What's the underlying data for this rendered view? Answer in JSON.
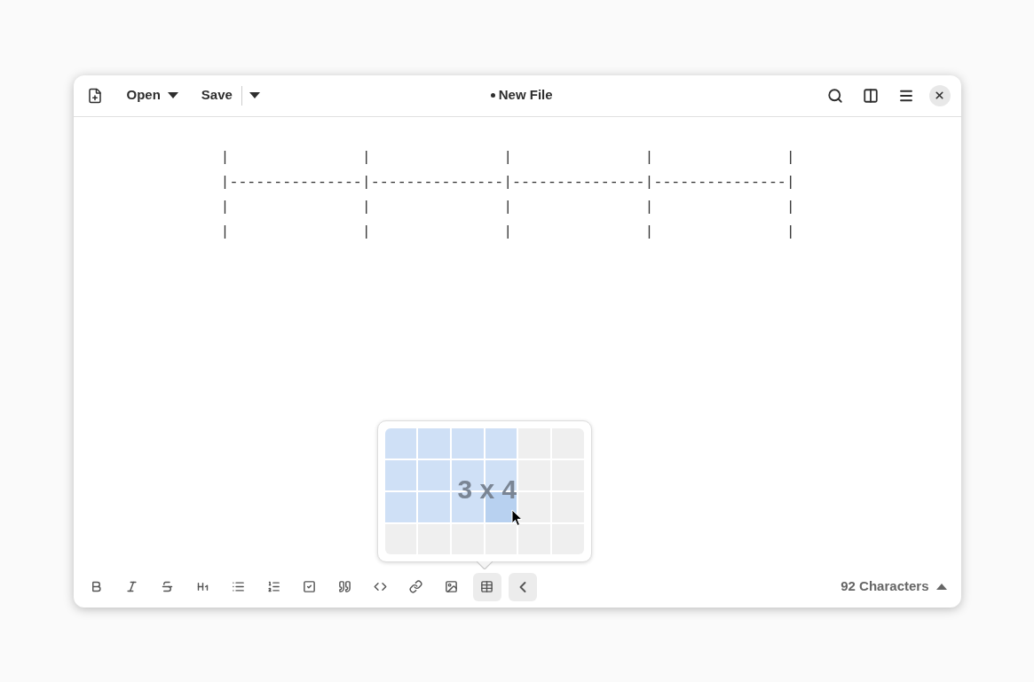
{
  "header": {
    "open_label": "Open",
    "save_label": "Save",
    "title": "New File",
    "modified": true
  },
  "editor": {
    "lines": [
      "|               |               |               |               |",
      "|---------------|---------------|---------------|---------------|",
      "|               |               |               |               |",
      "|               |               |               |               |"
    ]
  },
  "table_picker": {
    "label": "3 x 4",
    "rows": [
      [
        {
          "selected": true,
          "hovered": false
        },
        {
          "selected": true,
          "hovered": false
        },
        {
          "selected": true,
          "hovered": false
        },
        {
          "selected": true,
          "hovered": false
        },
        {
          "selected": false,
          "hovered": false
        },
        {
          "selected": false,
          "hovered": false
        }
      ],
      [
        {
          "selected": true,
          "hovered": false
        },
        {
          "selected": true,
          "hovered": false
        },
        {
          "selected": true,
          "hovered": false
        },
        {
          "selected": true,
          "hovered": false
        },
        {
          "selected": false,
          "hovered": false
        },
        {
          "selected": false,
          "hovered": false
        }
      ],
      [
        {
          "selected": true,
          "hovered": false
        },
        {
          "selected": true,
          "hovered": false
        },
        {
          "selected": true,
          "hovered": false
        },
        {
          "selected": true,
          "hovered": true
        },
        {
          "selected": false,
          "hovered": false
        },
        {
          "selected": false,
          "hovered": false
        }
      ],
      [
        {
          "selected": false,
          "hovered": false
        },
        {
          "selected": false,
          "hovered": false
        },
        {
          "selected": false,
          "hovered": false
        },
        {
          "selected": false,
          "hovered": false
        },
        {
          "selected": false,
          "hovered": false
        },
        {
          "selected": false,
          "hovered": false
        }
      ]
    ]
  },
  "toolbar": [
    {
      "kind": "bold",
      "selected": false
    },
    {
      "kind": "italic",
      "selected": false
    },
    {
      "kind": "strike",
      "selected": false
    },
    {
      "kind": "heading",
      "selected": false
    },
    {
      "kind": "bullets",
      "selected": false
    },
    {
      "kind": "numbers",
      "selected": false
    },
    {
      "kind": "check",
      "selected": false
    },
    {
      "kind": "quote",
      "selected": false
    },
    {
      "kind": "code",
      "selected": false
    },
    {
      "kind": "link",
      "selected": false
    },
    {
      "kind": "image",
      "selected": false
    },
    {
      "kind": "table",
      "selected": true
    },
    {
      "kind": "collapse",
      "selected": true
    }
  ],
  "status": {
    "count": "92 Characters"
  }
}
